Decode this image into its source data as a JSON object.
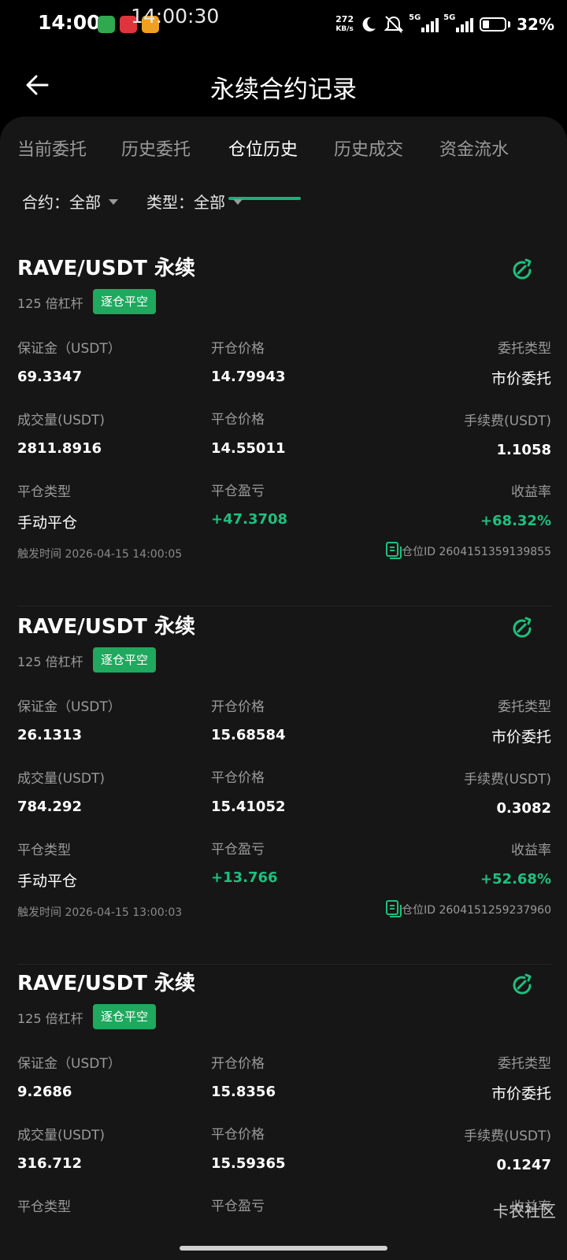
{
  "status_bar": {
    "time": "14:00",
    "overlay_clock": "14:00:30",
    "net_speed": "272",
    "net_speed_unit": "KB/s",
    "signal1": "5G",
    "signal2": "5G",
    "battery": "32%",
    "notif_colors": [
      "#2fa84f",
      "#e0343c",
      "#f0a020"
    ]
  },
  "header": {
    "title": "永续合约记录"
  },
  "tabs": [
    "当前委托",
    "历史委托",
    "仓位历史",
    "历史成交",
    "资金流水"
  ],
  "active_tab": "仓位历史",
  "filters": {
    "contract": "合约：全部",
    "type": "类型：全部"
  },
  "labels": {
    "margin": "保证金（USDT）",
    "open_price": "开仓价格",
    "order_type": "委托类型",
    "volume": "成交量(USDT)",
    "close_price": "平仓价格",
    "fee": "手续费(USDT)",
    "close_type": "平仓类型",
    "pnl": "平仓盈亏",
    "yield": "收益率"
  },
  "cards": [
    {
      "title": "RAVE/USDT 永续",
      "leverage": "125 倍杠杆",
      "mode": "逐仓平空",
      "margin": "69.3347",
      "open_price": "14.79943",
      "order_type": "市价委托",
      "volume": "2811.8916",
      "close_price": "14.55011",
      "fee": "1.1058",
      "close_type": "手动平仓",
      "pnl": "+47.3708",
      "yield": "+68.32%",
      "trigger_time": "触发时间 2026-04-15 14:00:05",
      "position_id": "仓位ID 2604151359139855"
    },
    {
      "title": "RAVE/USDT 永续",
      "leverage": "125 倍杠杆",
      "mode": "逐仓平空",
      "margin": "26.1313",
      "open_price": "15.68584",
      "order_type": "市价委托",
      "volume": "784.292",
      "close_price": "15.41052",
      "fee": "0.3082",
      "close_type": "手动平仓",
      "pnl": "+13.766",
      "yield": "+52.68%",
      "trigger_time": "触发时间 2026-04-15 13:00:03",
      "position_id": "仓位ID 2604151259237960"
    },
    {
      "title": "RAVE/USDT 永续",
      "leverage": "125 倍杠杆",
      "mode": "逐仓平空",
      "margin": "9.2686",
      "open_price": "15.8356",
      "order_type": "市价委托",
      "volume": "316.712",
      "close_price": "15.59365",
      "fee": "0.1247"
    }
  ],
  "watermark": "卡农社区",
  "colors": {
    "accent_green": "#1ec07e",
    "badge_green": "#1fa85e",
    "background": "#161616"
  }
}
